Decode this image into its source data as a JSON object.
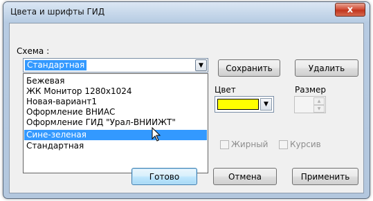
{
  "window": {
    "title": "Цвета и шрифты ГИД",
    "close_glyph": "x"
  },
  "scheme": {
    "label": "Схема :",
    "selected": "Стандартная",
    "options": [
      "Бежевая",
      "ЖК Монитор 1280x1024",
      "Новая-вариант1",
      "Оформление ВНИАС",
      "Оформление ГИД \"Урал-ВНИИЖТ\"",
      "Сине-зеленая",
      "Стандартная"
    ],
    "highlighted_option": "Сине-зеленая"
  },
  "buttons": {
    "save": "Сохранить",
    "delete": "Удалить",
    "ok": "Готово",
    "cancel": "Отмена",
    "apply": "Применить"
  },
  "color": {
    "label": "Цвет",
    "value": "#ffff00"
  },
  "size": {
    "label": "Размер"
  },
  "font_style": {
    "bold": "Жирный",
    "italic": "Курсив"
  },
  "icons": {
    "dropdown_arrow": "chevron-down-icon",
    "close": "close-icon",
    "cursor": "mouse-pointer-icon"
  }
}
